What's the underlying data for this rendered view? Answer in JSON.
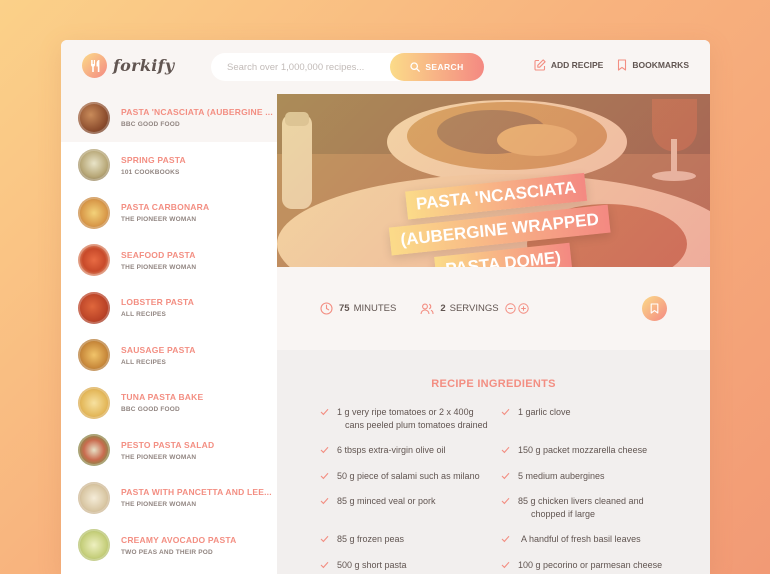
{
  "header": {
    "logo_text": "forkify",
    "search_placeholder": "Search over 1,000,000 recipes...",
    "search_button_label": "SEARCH",
    "add_recipe_label": "ADD RECIPE",
    "bookmarks_label": "BOOKMARKS"
  },
  "colors": {
    "primary_light": "#fbdb89",
    "primary_dark": "#f48982",
    "text": "#615551",
    "accent_text": "#f38e82",
    "sidebar_bg": "#ffffff",
    "panel_bg": "#f9f5f3"
  },
  "results": [
    {
      "title": "PASTA 'NCASCIATA (AUBERGINE ...",
      "publisher": "BBC GOOD FOOD",
      "active": true
    },
    {
      "title": "SPRING PASTA",
      "publisher": "101 COOKBOOKS"
    },
    {
      "title": "PASTA CARBONARA",
      "publisher": "THE PIONEER WOMAN"
    },
    {
      "title": "SEAFOOD PASTA",
      "publisher": "THE PIONEER WOMAN"
    },
    {
      "title": "LOBSTER PASTA",
      "publisher": "ALL RECIPES"
    },
    {
      "title": "SAUSAGE PASTA",
      "publisher": "ALL RECIPES"
    },
    {
      "title": "TUNA PASTA BAKE",
      "publisher": "BBC GOOD FOOD"
    },
    {
      "title": "PESTO PASTA SALAD",
      "publisher": "THE PIONEER WOMAN"
    },
    {
      "title": "PASTA WITH PANCETTA AND LEE...",
      "publisher": "THE PIONEER WOMAN"
    },
    {
      "title": "CREAMY AVOCADO PASTA",
      "publisher": "TWO PEAS AND THEIR POD"
    }
  ],
  "recipe": {
    "title_lines": [
      "PASTA 'NCASCIATA",
      "(AUBERGINE WRAPPED",
      "PASTA DOME)"
    ],
    "cooking_time": "75",
    "cooking_time_unit": "MINUTES",
    "servings": "2",
    "servings_unit": "SERVINGS",
    "ingredients_heading": "RECIPE INGREDIENTS",
    "ingredients": [
      {
        "text": "1 g very ripe tomatoes or 2 x 400g",
        "text2": "cans peeled plum tomatoes drained"
      },
      {
        "text": "1 garlic clove"
      },
      {
        "text": "6 tbsps extra-virgin olive oil"
      },
      {
        "text": "150 g packet mozzarella cheese"
      },
      {
        "text": "50 g piece of salami such as milano"
      },
      {
        "text": "5 medium aubergines"
      },
      {
        "text": "85 g minced veal or pork"
      },
      {
        "text": "85 g chicken livers cleaned and",
        "text2": "chopped if large"
      },
      {
        "text": "85 g frozen peas"
      },
      {
        "text": "A handful of fresh basil leaves"
      },
      {
        "text": "500 g short pasta"
      },
      {
        "text": "100 g pecorino or parmesan cheese"
      }
    ]
  }
}
